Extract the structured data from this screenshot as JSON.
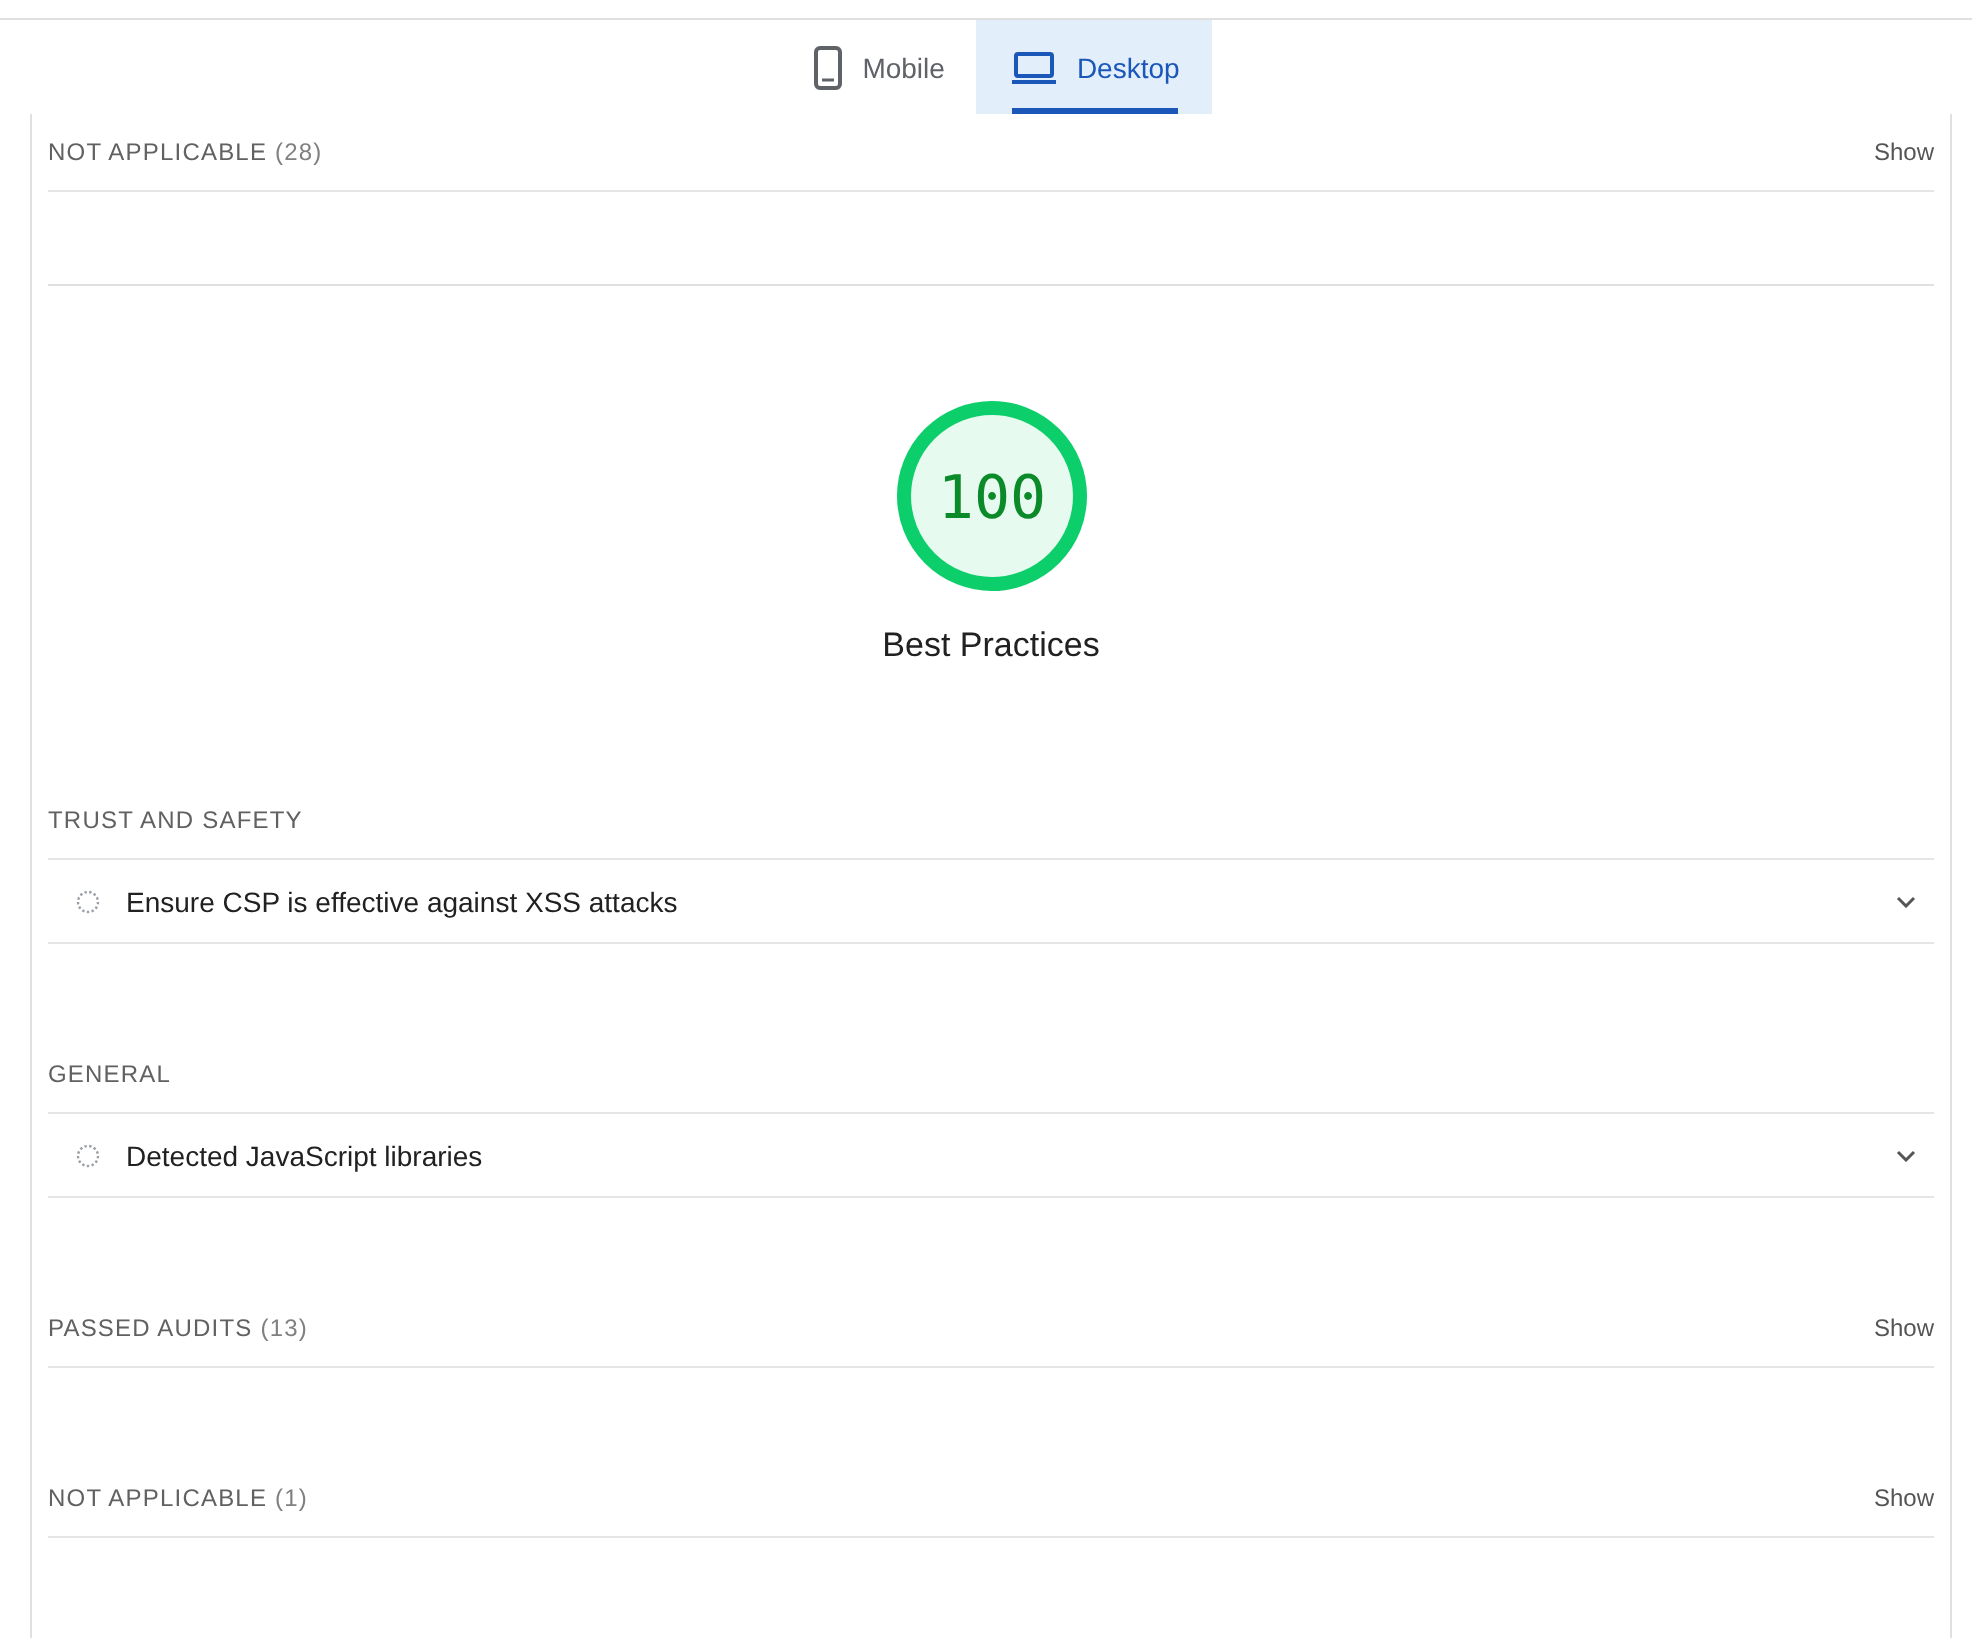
{
  "tabs": [
    {
      "label": "Mobile",
      "kind": "mobile",
      "selected": false
    },
    {
      "label": "Desktop",
      "kind": "desktop",
      "selected": true
    }
  ],
  "sections": [
    {
      "kind": "collapsed",
      "title": "NOT APPLICABLE",
      "count": "(28)",
      "action": "Show"
    },
    {
      "kind": "score",
      "score": "100",
      "level": 1,
      "title": "Best Practices"
    },
    {
      "kind": "group",
      "title": "TRUST AND SAFETY",
      "audits": [
        {
          "label": "Ensure CSP is effective against XSS attacks"
        }
      ]
    },
    {
      "kind": "group",
      "title": "GENERAL",
      "audits": [
        {
          "label": "Detected JavaScript libraries"
        }
      ]
    },
    {
      "kind": "collapsed",
      "title": "PASSED AUDITS",
      "count": "(13)",
      "action": "Show"
    },
    {
      "kind": "collapsed",
      "title": "NOT APPLICABLE",
      "count": "(1)",
      "action": "Show"
    }
  ]
}
